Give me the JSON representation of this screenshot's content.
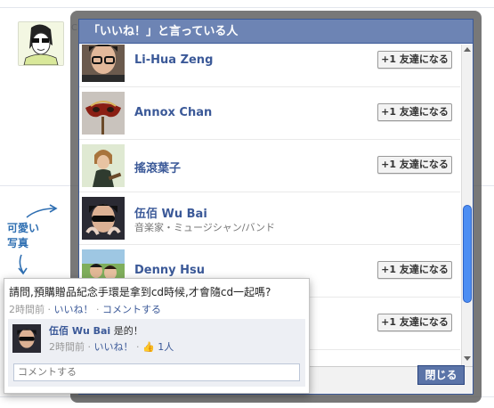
{
  "dialog": {
    "title": "「いいね！」と言っている人",
    "close_label": "閉じる",
    "people": [
      {
        "name": "Li-Hua Zeng",
        "subtitle": "",
        "button": "+1 友達になる"
      },
      {
        "name": "Annox Chan",
        "subtitle": "",
        "button": "+1 友達になる"
      },
      {
        "name": "搖滾葉子",
        "subtitle": "",
        "button": "+1 友達になる"
      },
      {
        "name": "伍佰 Wu Bai",
        "subtitle": "音楽家・ミュージシャン/バンド",
        "button": ""
      },
      {
        "name": "Denny Hsu",
        "subtitle": "",
        "button": "+1 友達になる"
      },
      {
        "name": "",
        "subtitle": "",
        "button": "+1 友達になる"
      }
    ]
  },
  "annotation": {
    "line1": "可愛い",
    "line2": "写真"
  },
  "comment_popup": {
    "question": "請問,預購贈品紀念手環是拿到cd時候,才會隨cd一起嗎?",
    "question_time": "2時間前",
    "question_like": "いいね！",
    "question_comment": "コメントする",
    "reply": {
      "name": "伍佰 Wu Bai",
      "text": "是的！",
      "time": "2時間前",
      "like": "いいね！",
      "like_count": "1人"
    },
    "comment_placeholder": "コメントする"
  },
  "colors": {
    "fb_blue": "#3b5998",
    "header_blue": "#6d84b4",
    "annotation_blue": "#2f6fb2",
    "scroll_thumb": "#4d8ef3"
  }
}
